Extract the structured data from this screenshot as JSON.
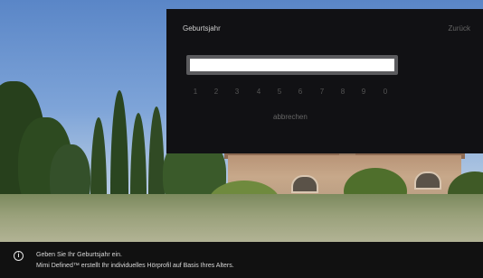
{
  "dialog": {
    "title": "Geburtsjahr",
    "back_label": "Zurück",
    "year_value": "",
    "digits": [
      "1",
      "2",
      "3",
      "4",
      "5",
      "6",
      "7",
      "8",
      "9",
      "0"
    ],
    "cancel_label": "abbrechen"
  },
  "info": {
    "icon": "info-icon",
    "line1": "Geben Sie Ihr Geburtsjahr ein.",
    "line2": "Mimi Defined™ erstellt Ihr individuelles Hörprofil auf Basis Ihres Alters."
  },
  "colors": {
    "panel_bg": "#111114",
    "field_bg": "#ffffff",
    "dim_text": "#666666",
    "info_bar_bg": "#111111"
  }
}
